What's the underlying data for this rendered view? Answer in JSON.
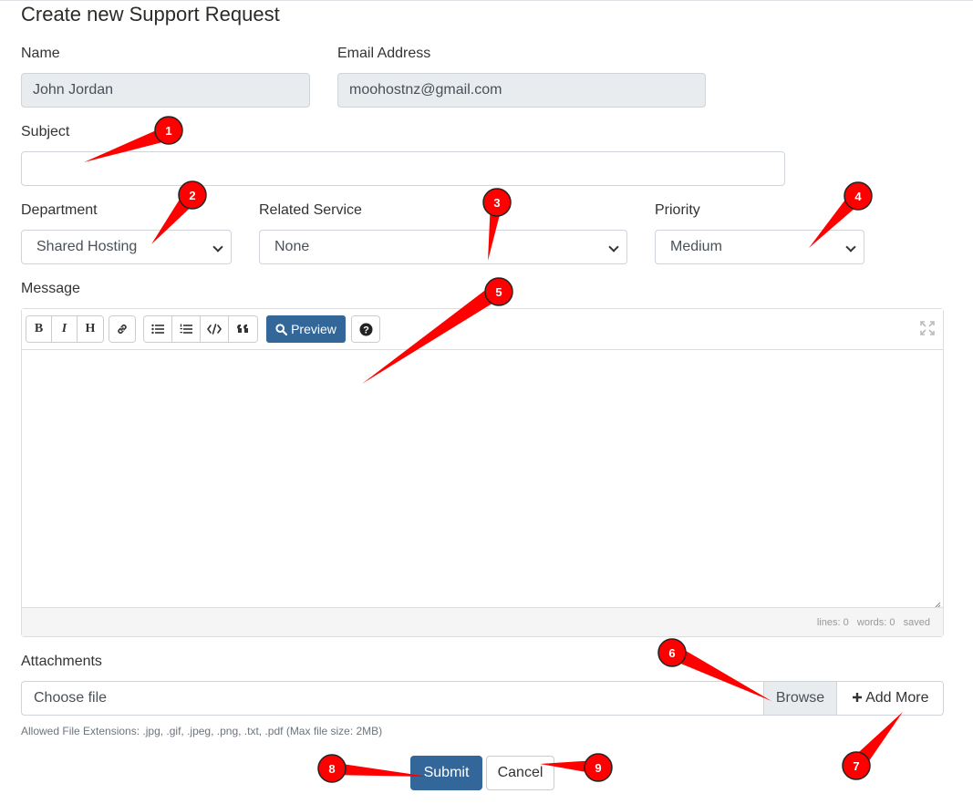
{
  "page": {
    "title": "Create new Support Request"
  },
  "form": {
    "name_label": "Name",
    "name_value": "John Jordan",
    "email_label": "Email Address",
    "email_value": "moohostnz@gmail.com",
    "subject_label": "Subject",
    "subject_value": "",
    "department_label": "Department",
    "department_value": "Shared Hosting",
    "service_label": "Related Service",
    "service_value": "None",
    "priority_label": "Priority",
    "priority_value": "Medium",
    "message_label": "Message"
  },
  "editor": {
    "toolbar": {
      "bold": "B",
      "italic": "I",
      "heading": "H",
      "preview_label": "Preview",
      "help": "?"
    },
    "status": {
      "lines": "lines: 0",
      "words": "words: 0",
      "saved": "saved"
    }
  },
  "attachments": {
    "label": "Attachments",
    "file_placeholder": "Choose file",
    "browse_label": "Browse",
    "add_more_label": "Add More",
    "hint": "Allowed File Extensions: .jpg, .gif, .jpeg, .png, .txt, .pdf (Max file size: 2MB)"
  },
  "actions": {
    "submit_label": "Submit",
    "cancel_label": "Cancel"
  },
  "annotations": [
    "1",
    "2",
    "3",
    "4",
    "5",
    "6",
    "7",
    "8",
    "9"
  ],
  "colors": {
    "primary": "#336699",
    "annotation": "#ff0000",
    "readonly_bg": "#e9ecef"
  }
}
